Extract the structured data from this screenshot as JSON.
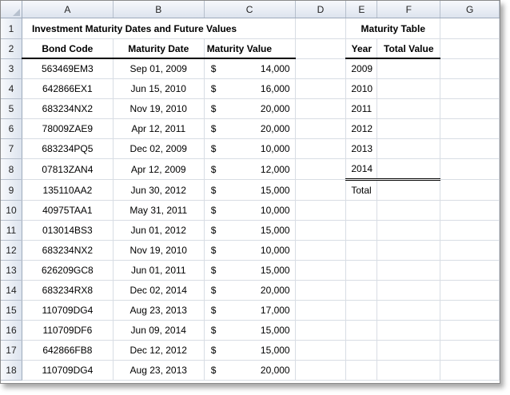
{
  "columns": [
    "A",
    "B",
    "C",
    "D",
    "E",
    "F",
    "G"
  ],
  "title": "Investment Maturity Dates and Future Values",
  "headers": {
    "bond_code": "Bond Code",
    "maturity_date": "Maturity Date",
    "maturity_value": "Maturity Value"
  },
  "currency_symbol": "$",
  "rows": [
    {
      "code": "563469EM3",
      "date": "Sep 01, 2009",
      "value": "14,000"
    },
    {
      "code": "642866EX1",
      "date": "Jun 15, 2010",
      "value": "16,000"
    },
    {
      "code": "683234NX2",
      "date": "Nov 19, 2010",
      "value": "20,000"
    },
    {
      "code": "78009ZAE9",
      "date": "Apr 12, 2011",
      "value": "20,000"
    },
    {
      "code": "683234PQ5",
      "date": "Dec 02, 2009",
      "value": "10,000"
    },
    {
      "code": "07813ZAN4",
      "date": "Apr 12, 2009",
      "value": "12,000"
    },
    {
      "code": "135110AA2",
      "date": "Jun 30, 2012",
      "value": "15,000"
    },
    {
      "code": "40975TAA1",
      "date": "May 31, 2011",
      "value": "10,000"
    },
    {
      "code": "013014BS3",
      "date": "Jun 01, 2012",
      "value": "15,000"
    },
    {
      "code": "683234NX2",
      "date": "Nov 19, 2010",
      "value": "10,000"
    },
    {
      "code": "626209GC8",
      "date": "Jun 01, 2011",
      "value": "15,000"
    },
    {
      "code": "683234RX8",
      "date": "Dec 02, 2014",
      "value": "20,000"
    },
    {
      "code": "110709DG4",
      "date": "Aug 23, 2013",
      "value": "17,000"
    },
    {
      "code": "110709DF6",
      "date": "Jun 09, 2014",
      "value": "15,000"
    },
    {
      "code": "642866FB8",
      "date": "Dec 12, 2012",
      "value": "15,000"
    },
    {
      "code": "110709DG4",
      "date": "Aug 23, 2013",
      "value": "20,000"
    }
  ],
  "maturity_table": {
    "title": "Maturity Table",
    "year_header": "Year",
    "total_value_header": "Total Value",
    "years": [
      "2009",
      "2010",
      "2011",
      "2012",
      "2013",
      "2014"
    ],
    "total_label": "Total"
  }
}
